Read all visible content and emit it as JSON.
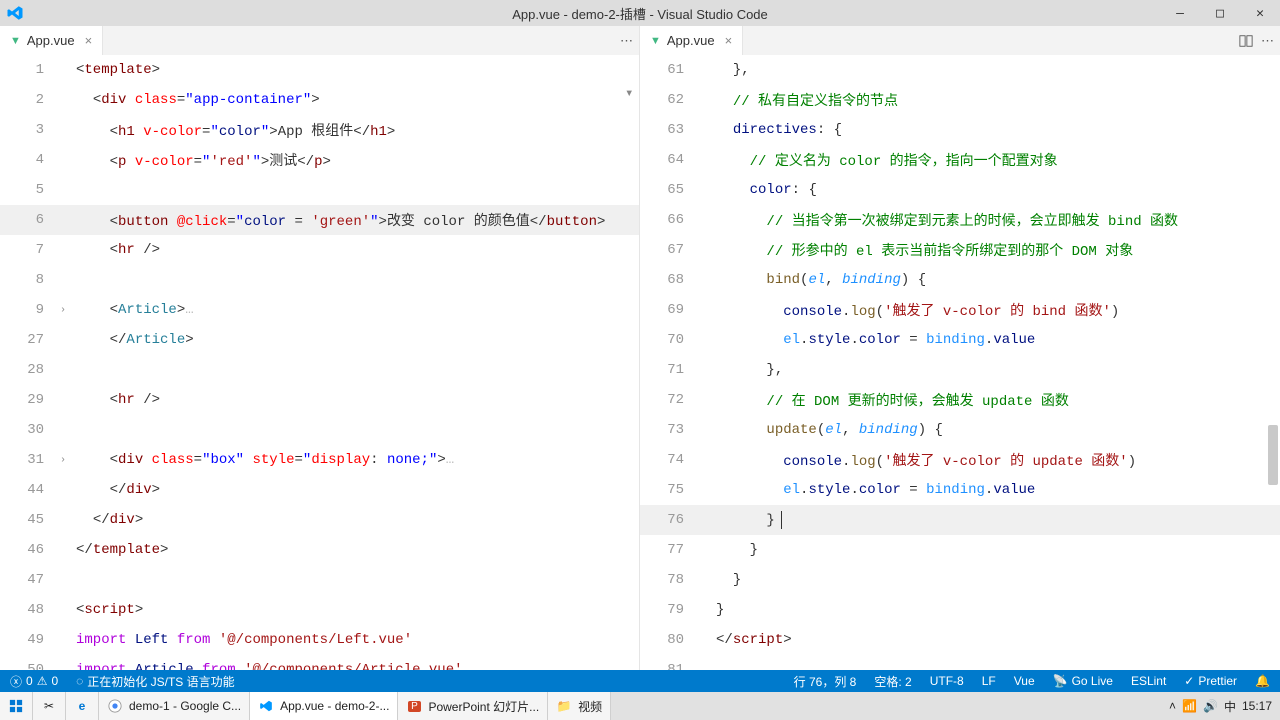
{
  "window": {
    "title": "App.vue - demo-2-插槽 - Visual Studio Code"
  },
  "groups": [
    {
      "tab": {
        "filename": "App.vue",
        "lang": "vue"
      },
      "tab_actions": [
        "ellipsis"
      ],
      "code_lines": [
        {
          "n": 1,
          "fold": "",
          "html": "<span class='t-punct'>&lt;</span><span class='t-brown'>template</span><span class='t-punct'>&gt;</span>"
        },
        {
          "n": 2,
          "fold": "",
          "html": "  <span class='t-punct'>&lt;</span><span class='t-brown'>div</span> <span class='t-red'>class</span>=<span class='t-blue'>\"app-container\"</span><span class='t-punct'>&gt;</span>"
        },
        {
          "n": 3,
          "fold": "",
          "html": "    <span class='t-punct'>&lt;</span><span class='t-brown'>h1</span> <span class='t-red'>v-color</span>=<span class='t-blue'>\"</span><span class='t-navy'>color</span><span class='t-blue'>\"</span><span class='t-punct'>&gt;</span>App 根组件<span class='t-punct'>&lt;/</span><span class='t-brown'>h1</span><span class='t-punct'>&gt;</span>"
        },
        {
          "n": 4,
          "fold": "",
          "html": "    <span class='t-punct'>&lt;</span><span class='t-brown'>p</span> <span class='t-red'>v-color</span>=<span class='t-blue'>\"</span><span class='t-str'>'red'</span><span class='t-blue'>\"</span><span class='t-punct'>&gt;</span>测试<span class='t-punct'>&lt;/</span><span class='t-brown'>p</span><span class='t-punct'>&gt;</span>"
        },
        {
          "n": 5,
          "fold": "",
          "html": ""
        },
        {
          "n": 6,
          "fold": "",
          "hi": true,
          "html": "    <span class='t-punct'>&lt;</span><span class='t-brown'>button</span> <span class='t-red'>@click</span>=<span class='t-blue'>\"</span><span class='t-navy'>color</span> = <span class='t-str'>'green'</span><span class='t-blue'>\"</span><span class='t-punct'>&gt;</span>改变 color 的颜色值<span class='t-punct'>&lt;/</span><span class='t-brown'>button</span><span class='t-punct'>&gt;</span>"
        },
        {
          "n": 7,
          "fold": "",
          "html": "    <span class='t-punct'>&lt;</span><span class='t-brown'>hr</span> <span class='t-punct'>/&gt;</span>"
        },
        {
          "n": 8,
          "fold": "",
          "html": ""
        },
        {
          "n": 9,
          "fold": ">",
          "html": "    <span class='t-punct'>&lt;</span><span class='t-teal'>Article</span><span class='t-punct'>&gt;</span><span class='dots'>&hellip;</span>"
        },
        {
          "n": 27,
          "fold": "",
          "html": "    <span class='t-punct'>&lt;/</span><span class='t-teal'>Article</span><span class='t-punct'>&gt;</span>"
        },
        {
          "n": 28,
          "fold": "",
          "html": ""
        },
        {
          "n": 29,
          "fold": "",
          "html": "    <span class='t-punct'>&lt;</span><span class='t-brown'>hr</span> <span class='t-punct'>/&gt;</span>"
        },
        {
          "n": 30,
          "fold": "",
          "html": ""
        },
        {
          "n": 31,
          "fold": ">",
          "html": "    <span class='t-punct'>&lt;</span><span class='t-brown'>div</span> <span class='t-red'>class</span>=<span class='t-blue'>\"box\"</span> <span class='t-red'>style</span>=<span class='t-blue'>\"</span><span class='t-red'>display</span>: <span class='t-blue'>none;</span><span class='t-blue'>\"</span><span class='t-punct'>&gt;</span><span class='dots'>&hellip;</span>"
        },
        {
          "n": 44,
          "fold": "",
          "html": "    <span class='t-punct'>&lt;/</span><span class='t-brown'>div</span><span class='t-punct'>&gt;</span>"
        },
        {
          "n": 45,
          "fold": "",
          "html": "  <span class='t-punct'>&lt;/</span><span class='t-brown'>div</span><span class='t-punct'>&gt;</span>"
        },
        {
          "n": 46,
          "fold": "",
          "html": "<span class='t-punct'>&lt;/</span><span class='t-brown'>template</span><span class='t-punct'>&gt;</span>"
        },
        {
          "n": 47,
          "fold": "",
          "html": ""
        },
        {
          "n": 48,
          "fold": "",
          "html": "<span class='t-punct'>&lt;</span><span class='t-brown'>script</span><span class='t-punct'>&gt;</span>"
        },
        {
          "n": 49,
          "fold": "",
          "html": "<span class='t-purple'>import</span> <span class='t-navy'>Left</span> <span class='t-purple'>from</span> <span class='t-str'>'@/components/Left.vue'</span>"
        },
        {
          "n": 50,
          "fold": "",
          "html": "<span class='t-purple'>import</span> <span class='t-navy'>Article</span> <span class='t-purple'>from</span> <span class='t-str'>'@/components/Article.vue'</span>"
        }
      ]
    },
    {
      "tab": {
        "filename": "App.vue",
        "lang": "vue"
      },
      "tab_actions": [
        "split",
        "ellipsis"
      ],
      "code_lines": [
        {
          "n": 61,
          "fold": "",
          "html": "  <span class='t-punct'>},</span>"
        },
        {
          "n": 62,
          "fold": "",
          "html": "  <span class='t-green'>// 私有自定义指令的节点</span>"
        },
        {
          "n": 63,
          "fold": "",
          "html": "  <span class='t-navy'>directives</span>: <span class='t-punct'>{</span>"
        },
        {
          "n": 64,
          "fold": "",
          "html": "    <span class='t-green'>// 定义名为 color 的指令，指向一个配置对象</span>"
        },
        {
          "n": 65,
          "fold": "",
          "html": "    <span class='t-navy'>color</span>: <span class='t-punct'>{</span>"
        },
        {
          "n": 66,
          "fold": "",
          "html": "      <span class='t-green'>// 当指令第一次被绑定到元素上的时候，会立即触发 bind 函数</span>"
        },
        {
          "n": 67,
          "fold": "",
          "html": "      <span class='t-green'>// 形参中的 el 表示当前指令所绑定到的那个 DOM 对象</span>"
        },
        {
          "n": 68,
          "fold": "",
          "html": "      <span class='t-olive'>bind</span>(<span style='color:#1e90ff;font-style:italic;'>el</span>, <span style='color:#1e90ff;font-style:italic;'>binding</span>) <span class='t-punct'>{</span>"
        },
        {
          "n": 69,
          "fold": "",
          "html": "        <span class='t-navy'>console</span>.<span class='t-olive'>log</span>(<span class='t-str'>'触发了 v-color 的 bind 函数'</span>)"
        },
        {
          "n": 70,
          "fold": "",
          "html": "        <span style='color:#1e90ff;'>el</span>.<span class='t-navy'>style</span>.<span class='t-navy'>color</span> = <span style='color:#1e90ff;'>binding</span>.<span class='t-navy'>value</span>"
        },
        {
          "n": 71,
          "fold": "",
          "html": "      <span class='t-punct'>},</span>"
        },
        {
          "n": 72,
          "fold": "",
          "html": "      <span class='t-green'>// 在 DOM 更新的时候，会触发 update 函数</span>"
        },
        {
          "n": 73,
          "fold": "",
          "html": "      <span class='t-olive'>update</span>(<span style='color:#1e90ff;font-style:italic;'>el</span>, <span style='color:#1e90ff;font-style:italic;'>binding</span>) <span class='t-punct'>{</span>"
        },
        {
          "n": 74,
          "fold": "",
          "html": "        <span class='t-navy'>console</span>.<span class='t-olive'>log</span>(<span class='t-str'>'触发了 v-color 的 update 函数'</span>)"
        },
        {
          "n": 75,
          "fold": "",
          "html": "        <span style='color:#1e90ff;'>el</span>.<span class='t-navy'>style</span>.<span class='t-navy'>color</span> = <span style='color:#1e90ff;'>binding</span>.<span class='t-navy'>value</span>"
        },
        {
          "n": 76,
          "fold": "",
          "hi": true,
          "cursor": true,
          "html": "      <span class='t-punct'>}</span>"
        },
        {
          "n": 77,
          "fold": "",
          "html": "    <span class='t-punct'>}</span>"
        },
        {
          "n": 78,
          "fold": "",
          "html": "  <span class='t-punct'>}</span>"
        },
        {
          "n": 79,
          "fold": "",
          "html": "<span class='t-punct'>}</span>"
        },
        {
          "n": 80,
          "fold": "",
          "html": "<span class='t-punct'>&lt;/</span><span class='t-brown'>script</span><span class='t-punct'>&gt;</span>"
        },
        {
          "n": 81,
          "fold": "",
          "html": ""
        }
      ]
    }
  ],
  "statusbar": {
    "left": {
      "errors": "0",
      "warnings": "0",
      "initializing": "正在初始化 JS/TS 语言功能"
    },
    "right": {
      "line_col": "行 76，列 8",
      "spaces": "空格: 2",
      "encoding": "UTF-8",
      "eol": "LF",
      "language": "Vue",
      "golive": "Go Live",
      "eslint": "ESLint",
      "prettier": "Prettier"
    }
  },
  "taskbar": {
    "items": [
      {
        "label": "",
        "icon": "windows"
      },
      {
        "label": "",
        "icon": "snip"
      },
      {
        "label": "",
        "icon": "edge"
      },
      {
        "label": "demo-1 - Google C...",
        "icon": "chrome"
      },
      {
        "label": "App.vue - demo-2-...",
        "icon": "vscode",
        "active": true
      },
      {
        "label": "PowerPoint 幻灯片...",
        "icon": "powerpoint"
      },
      {
        "label": "视频",
        "icon": "folder"
      }
    ],
    "tray_time": "15:17"
  }
}
